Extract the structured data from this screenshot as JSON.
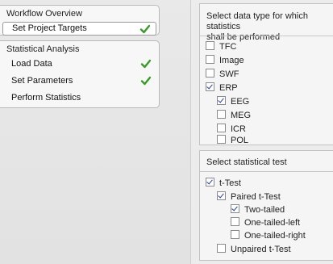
{
  "workflow": {
    "overview_label": "Workflow Overview",
    "set_targets_label": "Set Project Targets"
  },
  "analysis": {
    "title": "Statistical Analysis",
    "items": [
      {
        "label": "Load Data",
        "done": true
      },
      {
        "label": "Set Parameters",
        "done": true
      },
      {
        "label": "Perform Statistics",
        "done": false
      }
    ]
  },
  "data_types": {
    "heading_line1": "Select data type for which statistics",
    "heading_line2": "shall be performed",
    "options": [
      {
        "label": "TFC",
        "checked": false
      },
      {
        "label": "Image",
        "checked": false
      },
      {
        "label": "SWF",
        "checked": false
      },
      {
        "label": "ERP",
        "checked": true
      }
    ],
    "erp_options": [
      {
        "label": "EEG",
        "checked": true
      },
      {
        "label": "MEG",
        "checked": false
      },
      {
        "label": "ICR",
        "checked": false
      },
      {
        "label": "POL",
        "checked": false
      }
    ]
  },
  "stat_test": {
    "heading": "Select statistical test",
    "ttest": {
      "label": "t-Test",
      "checked": true
    },
    "paired": {
      "label": "Paired t-Test",
      "checked": true
    },
    "paired_options": [
      {
        "label": "Two-tailed",
        "checked": true
      },
      {
        "label": "One-tailed-left",
        "checked": false
      },
      {
        "label": "One-tailed-right",
        "checked": false
      }
    ],
    "unpaired": {
      "label": "Unpaired t-Test",
      "checked": false
    }
  },
  "colors": {
    "check_green": "#3a9a2a",
    "checkbox_tick": "#1d3fa8"
  }
}
